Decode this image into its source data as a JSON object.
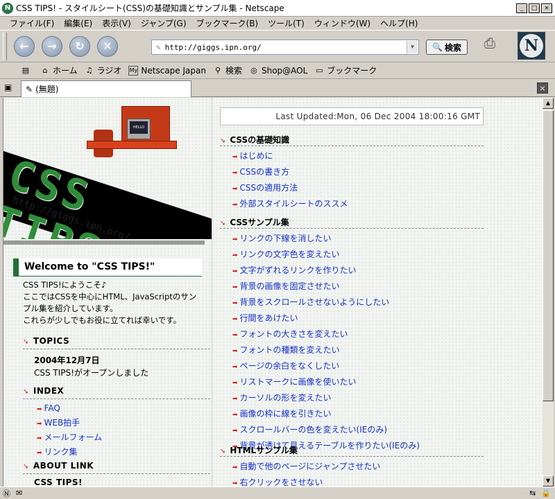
{
  "window": {
    "title": "CSS TIPS! - スタイルシート(CSS)の基礎知識とサンプル集 - Netscape",
    "app_icon": "N",
    "buttons": [
      "_",
      "□",
      "×"
    ]
  },
  "menu": [
    "ファイル(F)",
    "編集(E)",
    "表示(V)",
    "ジャンプ(G)",
    "ブックマーク(B)",
    "ツール(T)",
    "ウィンドウ(W)",
    "ヘルプ(H)"
  ],
  "nav": {
    "url": "http://giggs.ipn.org/",
    "search_label": "検索",
    "logo_letter": "N"
  },
  "personal_toolbar": [
    {
      "icon": "home-icon",
      "label": "ホーム"
    },
    {
      "icon": "radio-icon",
      "label": "ラジオ"
    },
    {
      "icon": "my-icon",
      "label": "Netscape Japan"
    },
    {
      "icon": "search-icon",
      "label": "検索"
    },
    {
      "icon": "shop-icon",
      "label": "Shop@AOL"
    },
    {
      "icon": "bookmark-folder-icon",
      "label": "ブックマーク"
    }
  ],
  "tab": {
    "label": "(無題)"
  },
  "page": {
    "logo_text": "CSS TIPS!",
    "logo_url": "http://giggs.ipn.org/",
    "desk_screen": "HELLO",
    "welcome": "Welcome to \"CSS TIPS!\"",
    "intro": [
      "CSS TIPS!にようこそ♪",
      "ここではCSSを中心にHTML、JavaScriptのサン",
      "プル集を紹介しています。",
      "これらが少しでもお役に立てれば幸いです。"
    ],
    "topics": {
      "title": "TOPICS",
      "date": "2004年12月7日",
      "text": "CSS TIPS!がオープンしました"
    },
    "index": {
      "title": "INDEX",
      "links": [
        "FAQ",
        "WEB拍手",
        "メールフォーム",
        "リンク集"
      ]
    },
    "about": {
      "title": "ABOUT LINK"
    },
    "cut_title": "CSS TIPS!",
    "last_updated": "Last Updated:Mon, 06 Dec 2004 18:00:16 GMT",
    "basics": {
      "title": "CSSの基礎知識",
      "links": [
        "はじめに",
        "CSSの書き方",
        "CSSの適用方法",
        "外部スタイルシートのススメ"
      ]
    },
    "samples": {
      "title": "CSSサンプル集",
      "links": [
        "リンクの下線を消したい",
        "リンクの文字色を変えたい",
        "文字がずれるリンクを作りたい",
        "背景の画像を固定させたい",
        "背景をスクロールさせないようにしたい",
        "行間をあけたい",
        "フォントの大きさを変えたい",
        "フォントの種類を変えたい",
        "ページの余白をなくしたい",
        "リストマークに画像を使いたい",
        "カーソルの形を変えたい",
        "画像の枠に線を引きたい",
        "スクロールバーの色を変えたい(IEのみ)",
        "背景が透けて見えるテーブルを作りたい(IEのみ)"
      ]
    },
    "html_samples": {
      "title": "HTMLサンプル集",
      "links": [
        "自動で他のページにジャンプさせたい",
        "右クリックをさせない"
      ]
    }
  },
  "colors": {
    "accent_red": "#d4261c",
    "link_blue": "#1530c8",
    "welcome_green": "#207038"
  }
}
